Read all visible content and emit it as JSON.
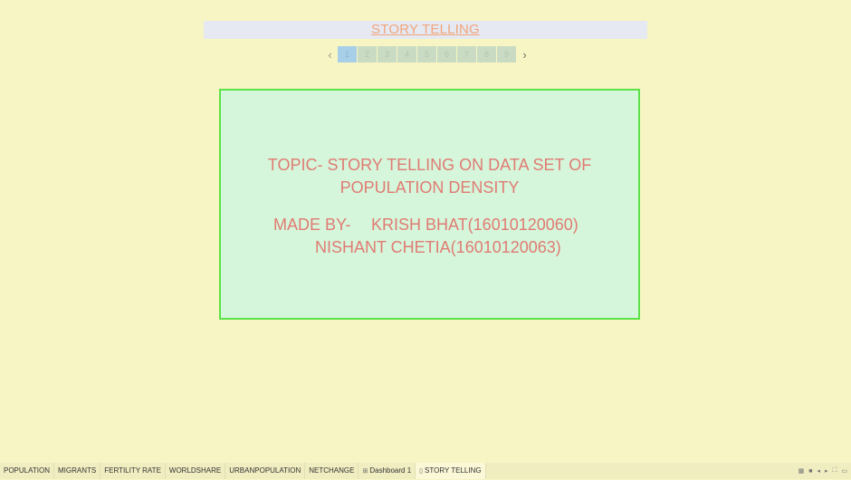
{
  "story": {
    "title": "STORY TELLING",
    "points": [
      "1",
      "2",
      "3",
      "4",
      "5",
      "6",
      "7",
      "8",
      "9"
    ],
    "active_point_index": 0,
    "prev_glyph": "‹",
    "next_glyph": "›"
  },
  "content": {
    "topic": "TOPIC- STORY TELLING ON DATA SET OF POPULATION DENSITY",
    "made_by_label": "MADE BY-",
    "author1": "KRISH BHAT(16010120060)",
    "author2": "NISHANT CHETIA(16010120063)"
  },
  "tabs": [
    {
      "label": "POPULATION",
      "icon": ""
    },
    {
      "label": "MIGRANTS",
      "icon": ""
    },
    {
      "label": "FERTILITY RATE",
      "icon": ""
    },
    {
      "label": "WORLDSHARE",
      "icon": ""
    },
    {
      "label": "URBANPOPULATION",
      "icon": ""
    },
    {
      "label": "NETCHANGE",
      "icon": ""
    },
    {
      "label": "Dashboard 1",
      "icon": "dashboard-icon"
    },
    {
      "label": "STORY TELLING",
      "icon": "story-icon"
    }
  ],
  "active_tab_index": 7,
  "status_bar_icons": [
    "grid-icon",
    "filmstrip-icon",
    "prev-icon",
    "next-icon",
    "fullscreen-icon",
    "comment-icon"
  ],
  "colors": {
    "background": "#f7f5c3",
    "story_box_fill": "#d5f6db",
    "story_box_border": "#5ce246",
    "text_accent": "#e07b73",
    "title_color": "#f0a47c"
  }
}
